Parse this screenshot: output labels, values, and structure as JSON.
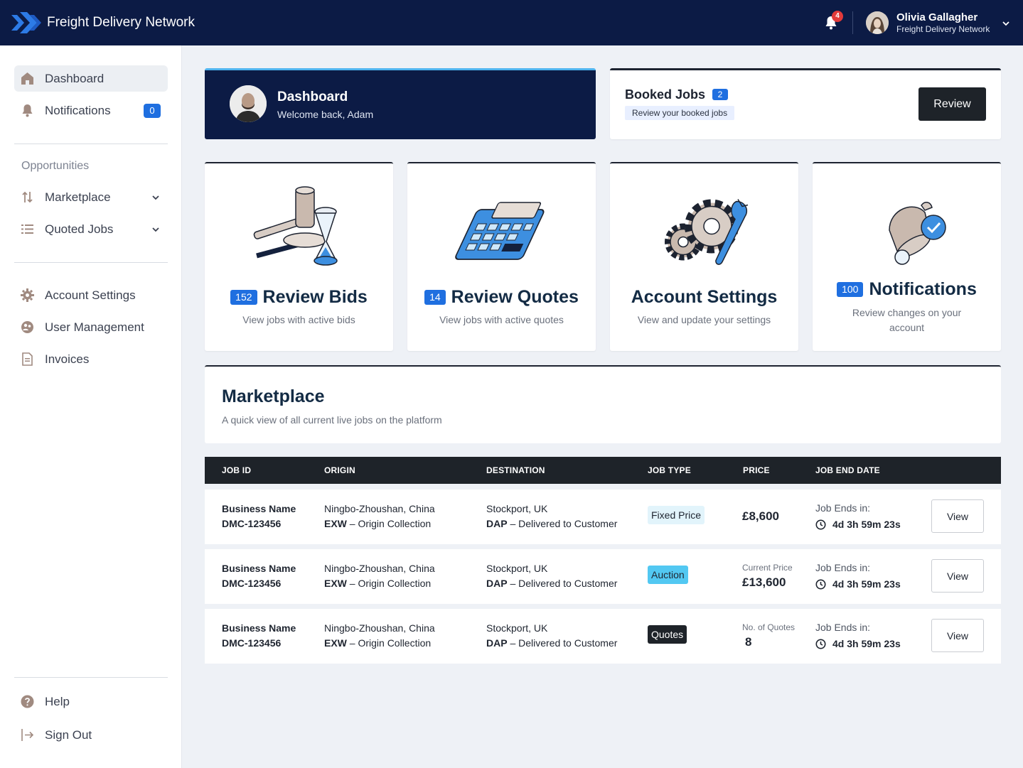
{
  "app": {
    "title": "Freight Delivery Network"
  },
  "header": {
    "notification_count": "4",
    "user": {
      "name": "Olivia Gallagher",
      "org": "Freight Delivery Network"
    }
  },
  "sidebar": {
    "items": [
      {
        "label": "Dashboard",
        "icon": "home-icon"
      },
      {
        "label": "Notifications",
        "icon": "bell-icon",
        "badge": "0"
      }
    ],
    "section_label": "Opportunities",
    "opportunities": [
      {
        "label": "Marketplace",
        "icon": "swap-icon"
      },
      {
        "label": "Quoted Jobs",
        "icon": "list-icon"
      }
    ],
    "settings": [
      {
        "label": "Account Settings",
        "icon": "gear-icon"
      },
      {
        "label": "User Management",
        "icon": "users-icon"
      },
      {
        "label": "Invoices",
        "icon": "invoice-icon"
      }
    ],
    "footer": [
      {
        "label": "Help",
        "icon": "help-icon"
      },
      {
        "label": "Sign Out",
        "icon": "sign-out-icon"
      }
    ]
  },
  "welcome": {
    "title": "Dashboard",
    "subtitle": "Welcome back, Adam"
  },
  "booked": {
    "title": "Booked Jobs",
    "count": "2",
    "subtitle": "Review your booked jobs",
    "button": "Review"
  },
  "tiles": [
    {
      "badge": "152",
      "title": "Review Bids",
      "subtitle": "View jobs with active bids",
      "icon": "gavel-hourglass-icon"
    },
    {
      "badge": "14",
      "title": "Review Quotes",
      "subtitle": "View jobs with active quotes",
      "icon": "calculator-icon"
    },
    {
      "title": "Account Settings",
      "subtitle": "View and update your settings",
      "icon": "gears-wrench-icon"
    },
    {
      "badge": "100",
      "title": "Notifications",
      "subtitle": "Review changes on your account",
      "icon": "bell-check-icon"
    }
  ],
  "marketplace": {
    "title": "Marketplace",
    "subtitle": "A quick view of all current live jobs on the platform",
    "columns": [
      "JOB ID",
      "ORIGIN",
      "DESTINATION",
      "JOB TYPE",
      "PRICE",
      "JOB END DATE"
    ],
    "rows": [
      {
        "business": "Business Name",
        "job_id": "DMC-123456",
        "origin": "Ningbo-Zhoushan, China",
        "origin_code": "EXW",
        "origin_desc": "– Origin Collection",
        "destination": "Stockport, UK",
        "dest_code": "DAP",
        "dest_desc": "– Delivered to Customer",
        "job_type": "Fixed Price",
        "price_label": "",
        "price": "£8,600",
        "ends_label": "Job Ends in:",
        "ends_time": "4d 3h 59m 23s",
        "button": "View"
      },
      {
        "business": "Business Name",
        "job_id": "DMC-123456",
        "origin": "Ningbo-Zhoushan, China",
        "origin_code": "EXW",
        "origin_desc": "– Origin Collection",
        "destination": "Stockport, UK",
        "dest_code": "DAP",
        "dest_desc": "– Delivered to Customer",
        "job_type": "Auction",
        "price_label": "Current Price",
        "price": "£13,600",
        "ends_label": "Job Ends in:",
        "ends_time": "4d 3h 59m 23s",
        "button": "View"
      },
      {
        "business": "Business Name",
        "job_id": "DMC-123456",
        "origin": "Ningbo-Zhoushan, China",
        "origin_code": "EXW",
        "origin_desc": "– Origin Collection",
        "destination": "Stockport, UK",
        "dest_code": "DAP",
        "dest_desc": "– Delivered to Customer",
        "job_type": "Quotes",
        "price_label": "No. of Quotes",
        "price": "8",
        "ends_label": "Job Ends in:",
        "ends_time": "4d 3h 59m 23s",
        "button": "View"
      }
    ]
  },
  "colors": {
    "navy": "#0c1b45",
    "accent_blue": "#1f6fe0",
    "light_blue": "#52c8f2",
    "dark": "#1e2329",
    "alert_red": "#e23a3a",
    "icon_brown": "#a08a80"
  }
}
